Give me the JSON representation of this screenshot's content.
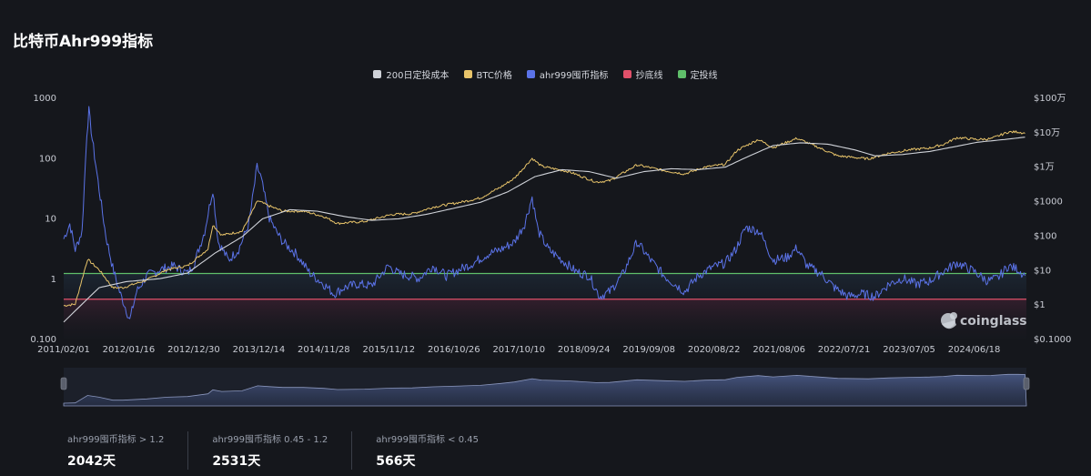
{
  "title": "比特币Ahr999指标",
  "legend": [
    {
      "label": "200日定投成本",
      "color": "#cfd2d8"
    },
    {
      "label": "BTC价格",
      "color": "#e8c46a"
    },
    {
      "label": "ahr999囤币指标",
      "color": "#5b73e8"
    },
    {
      "label": "抄底线",
      "color": "#e0506a"
    },
    {
      "label": "定投线",
      "color": "#5fbf6a"
    }
  ],
  "watermark": "coinglass",
  "chart_data": {
    "type": "line",
    "x_ticks": [
      "2011/02/01",
      "2012/01/16",
      "2012/12/30",
      "2013/12/14",
      "2014/11/28",
      "2015/11/12",
      "2016/10/26",
      "2017/10/10",
      "2018/09/24",
      "2019/09/08",
      "2020/08/22",
      "2021/08/06",
      "2022/07/21",
      "2023/07/05",
      "2024/06/18"
    ],
    "left_axis": {
      "scale": "log",
      "ticks": [
        "1000",
        "100",
        "10",
        "1",
        "0.100"
      ],
      "range": [
        0.1,
        1000
      ]
    },
    "right_axis": {
      "scale": "log",
      "ticks": [
        "$100万",
        "$10万",
        "$1万",
        "$1000",
        "$100",
        "$10",
        "$1",
        "$0.1000"
      ],
      "range": [
        0.1,
        1000000
      ]
    },
    "horizontal_lines": [
      {
        "name": "定投线",
        "value": 1.2
      },
      {
        "name": "抄底线",
        "value": 0.45
      }
    ],
    "series": [
      {
        "name": "ahr999囤币指标",
        "axis": "left",
        "points": [
          [
            2011.08,
            4.5
          ],
          [
            2011.17,
            8
          ],
          [
            2011.25,
            3
          ],
          [
            2011.35,
            6
          ],
          [
            2011.42,
            250
          ],
          [
            2011.45,
            600
          ],
          [
            2011.5,
            200
          ],
          [
            2011.6,
            30
          ],
          [
            2011.7,
            5
          ],
          [
            2011.8,
            1.5
          ],
          [
            2011.9,
            0.6
          ],
          [
            2012.0,
            0.3
          ],
          [
            2012.05,
            0.2
          ],
          [
            2012.15,
            0.6
          ],
          [
            2012.3,
            1.1
          ],
          [
            2012.5,
            1.4
          ],
          [
            2012.7,
            1.6
          ],
          [
            2012.9,
            1.2
          ],
          [
            2013.0,
            1.8
          ],
          [
            2013.15,
            6
          ],
          [
            2013.27,
            30
          ],
          [
            2013.35,
            4
          ],
          [
            2013.5,
            2
          ],
          [
            2013.65,
            3
          ],
          [
            2013.8,
            8
          ],
          [
            2013.92,
            70
          ],
          [
            2013.97,
            50
          ],
          [
            2014.1,
            10
          ],
          [
            2014.2,
            6
          ],
          [
            2014.3,
            4
          ],
          [
            2014.5,
            2.5
          ],
          [
            2014.7,
            1.2
          ],
          [
            2014.9,
            0.8
          ],
          [
            2015.05,
            0.55
          ],
          [
            2015.2,
            0.7
          ],
          [
            2015.4,
            0.8
          ],
          [
            2015.6,
            0.75
          ],
          [
            2015.85,
            1.6
          ],
          [
            2016.0,
            1.2
          ],
          [
            2016.3,
            1.0
          ],
          [
            2016.5,
            1.6
          ],
          [
            2016.7,
            1.1
          ],
          [
            2016.9,
            1.4
          ],
          [
            2017.1,
            1.8
          ],
          [
            2017.3,
            2.5
          ],
          [
            2017.5,
            3
          ],
          [
            2017.7,
            4
          ],
          [
            2017.85,
            8
          ],
          [
            2017.96,
            22
          ],
          [
            2018.05,
            6
          ],
          [
            2018.2,
            3
          ],
          [
            2018.4,
            2
          ],
          [
            2018.6,
            1.3
          ],
          [
            2018.8,
            1.1
          ],
          [
            2018.95,
            0.5
          ],
          [
            2019.1,
            0.6
          ],
          [
            2019.3,
            1.2
          ],
          [
            2019.5,
            4
          ],
          [
            2019.7,
            2
          ],
          [
            2019.9,
            1.1
          ],
          [
            2020.2,
            0.6
          ],
          [
            2020.4,
            1.1
          ],
          [
            2020.6,
            1.5
          ],
          [
            2020.8,
            1.8
          ],
          [
            2020.95,
            3
          ],
          [
            2021.1,
            7
          ],
          [
            2021.3,
            6
          ],
          [
            2021.5,
            2
          ],
          [
            2021.7,
            2.2
          ],
          [
            2021.85,
            3.2
          ],
          [
            2022.0,
            1.6
          ],
          [
            2022.2,
            1.2
          ],
          [
            2022.4,
            0.7
          ],
          [
            2022.6,
            0.5
          ],
          [
            2022.8,
            0.55
          ],
          [
            2023.0,
            0.5
          ],
          [
            2023.2,
            0.8
          ],
          [
            2023.4,
            1.0
          ],
          [
            2023.6,
            0.8
          ],
          [
            2023.8,
            0.9
          ],
          [
            2024.0,
            1.3
          ],
          [
            2024.2,
            1.8
          ],
          [
            2024.45,
            1.3
          ],
          [
            2024.65,
            0.9
          ],
          [
            2024.8,
            1.0
          ],
          [
            2024.95,
            1.6
          ],
          [
            2025.1,
            1.4
          ],
          [
            2025.2,
            1.1
          ]
        ]
      },
      {
        "name": "BTC价格",
        "axis": "right",
        "points": [
          [
            2011.08,
            0.9
          ],
          [
            2011.25,
            1
          ],
          [
            2011.43,
            20
          ],
          [
            2011.6,
            10
          ],
          [
            2011.8,
            3
          ],
          [
            2011.95,
            3
          ],
          [
            2012.3,
            5
          ],
          [
            2012.6,
            10
          ],
          [
            2012.9,
            13
          ],
          [
            2013.2,
            40
          ],
          [
            2013.27,
            200
          ],
          [
            2013.4,
            100
          ],
          [
            2013.7,
            130
          ],
          [
            2013.93,
            1000
          ],
          [
            2014.1,
            700
          ],
          [
            2014.3,
            500
          ],
          [
            2014.6,
            500
          ],
          [
            2014.9,
            350
          ],
          [
            2015.1,
            220
          ],
          [
            2015.5,
            250
          ],
          [
            2015.9,
            400
          ],
          [
            2016.2,
            420
          ],
          [
            2016.5,
            650
          ],
          [
            2016.9,
            900
          ],
          [
            2017.2,
            1200
          ],
          [
            2017.5,
            2500
          ],
          [
            2017.7,
            4500
          ],
          [
            2017.96,
            17000
          ],
          [
            2018.1,
            10000
          ],
          [
            2018.5,
            7000
          ],
          [
            2018.9,
            3500
          ],
          [
            2019.1,
            3800
          ],
          [
            2019.5,
            11000
          ],
          [
            2019.9,
            7500
          ],
          [
            2020.2,
            6000
          ],
          [
            2020.5,
            9500
          ],
          [
            2020.8,
            11500
          ],
          [
            2020.97,
            29000
          ],
          [
            2021.28,
            60000
          ],
          [
            2021.5,
            35000
          ],
          [
            2021.85,
            65000
          ],
          [
            2022.1,
            40000
          ],
          [
            2022.45,
            20000
          ],
          [
            2022.9,
            16500
          ],
          [
            2023.2,
            24000
          ],
          [
            2023.5,
            30000
          ],
          [
            2023.8,
            34000
          ],
          [
            2024.0,
            43000
          ],
          [
            2024.2,
            68000
          ],
          [
            2024.5,
            60000
          ],
          [
            2024.7,
            63000
          ],
          [
            2024.95,
            98000
          ],
          [
            2025.1,
            100000
          ],
          [
            2025.2,
            90000
          ]
        ]
      },
      {
        "name": "200日定投成本",
        "axis": "right",
        "points": [
          [
            2011.08,
            0.3
          ],
          [
            2011.3,
            0.8
          ],
          [
            2011.6,
            3
          ],
          [
            2012.0,
            4.5
          ],
          [
            2012.5,
            5.5
          ],
          [
            2012.9,
            8
          ],
          [
            2013.3,
            30
          ],
          [
            2013.7,
            90
          ],
          [
            2014.0,
            300
          ],
          [
            2014.4,
            550
          ],
          [
            2014.8,
            500
          ],
          [
            2015.2,
            350
          ],
          [
            2015.6,
            270
          ],
          [
            2016.0,
            300
          ],
          [
            2016.4,
            400
          ],
          [
            2016.8,
            600
          ],
          [
            2017.2,
            900
          ],
          [
            2017.6,
            1800
          ],
          [
            2018.0,
            5000
          ],
          [
            2018.4,
            8000
          ],
          [
            2018.8,
            7000
          ],
          [
            2019.2,
            4500
          ],
          [
            2019.6,
            7000
          ],
          [
            2020.0,
            8500
          ],
          [
            2020.4,
            8000
          ],
          [
            2020.8,
            9500
          ],
          [
            2021.1,
            18000
          ],
          [
            2021.5,
            40000
          ],
          [
            2021.9,
            48000
          ],
          [
            2022.3,
            44000
          ],
          [
            2022.7,
            30000
          ],
          [
            2023.0,
            20000
          ],
          [
            2023.4,
            22000
          ],
          [
            2023.8,
            27000
          ],
          [
            2024.1,
            35000
          ],
          [
            2024.5,
            50000
          ],
          [
            2024.9,
            60000
          ],
          [
            2025.2,
            70000
          ]
        ]
      }
    ]
  },
  "stats": [
    {
      "label": "ahr999囤币指标 > 1.2",
      "value": "2042天"
    },
    {
      "label": "ahr999囤币指标 0.45 - 1.2",
      "value": "2531天"
    },
    {
      "label": "ahr999囤币指标 < 0.45",
      "value": "566天"
    }
  ]
}
